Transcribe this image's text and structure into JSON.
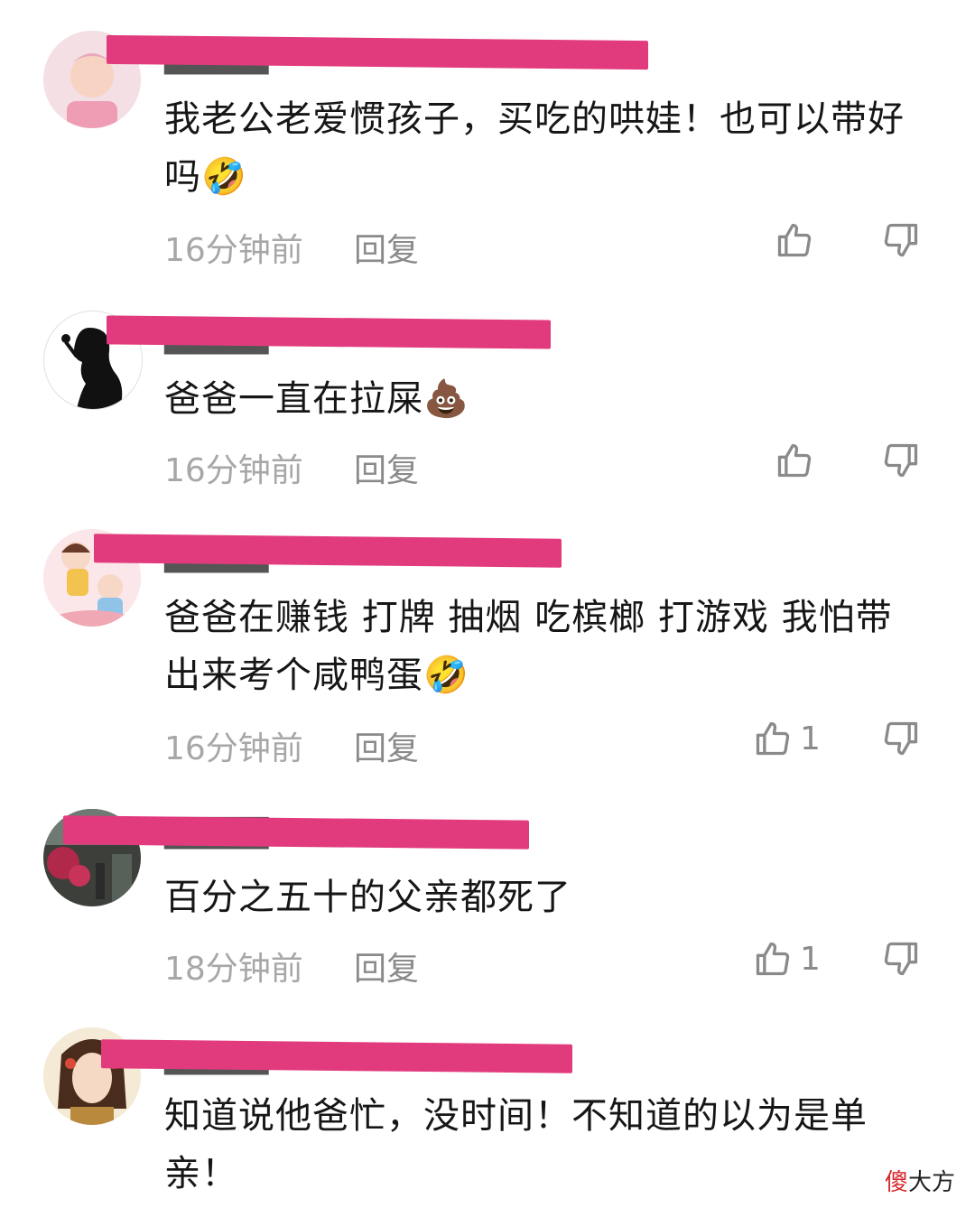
{
  "comments": [
    {
      "username": "█████",
      "text": "我老公老爱惯孩子，买吃的哄娃！也可以带好吗",
      "emoji": "🤣",
      "time": "16分钟前",
      "reply_label": "回复",
      "likes": ""
    },
    {
      "username": "█████",
      "text": "爸爸一直在拉屎",
      "emoji": "💩",
      "time": "16分钟前",
      "reply_label": "回复",
      "likes": ""
    },
    {
      "username": "█████",
      "text": "爸爸在赚钱 打牌 抽烟 吃槟榔 打游戏 我怕带出来考个咸鸭蛋",
      "emoji": "🤣",
      "time": "16分钟前",
      "reply_label": "回复",
      "likes": "1"
    },
    {
      "username": "█████",
      "text": "百分之五十的父亲都死了",
      "emoji": "",
      "time": "18分钟前",
      "reply_label": "回复",
      "likes": "1"
    },
    {
      "username": "█████",
      "text": "知道说他爸忙，没时间！不知道的以为是单亲！",
      "emoji": "",
      "time": "",
      "reply_label": "",
      "likes": ""
    }
  ],
  "icons": {
    "like": "thumbs-up-icon",
    "dislike": "thumbs-down-icon"
  },
  "colors": {
    "redaction": "#e23b7d",
    "meta_text": "#a7a7a7"
  },
  "watermark": {
    "first": "傻",
    "rest": "大方"
  }
}
